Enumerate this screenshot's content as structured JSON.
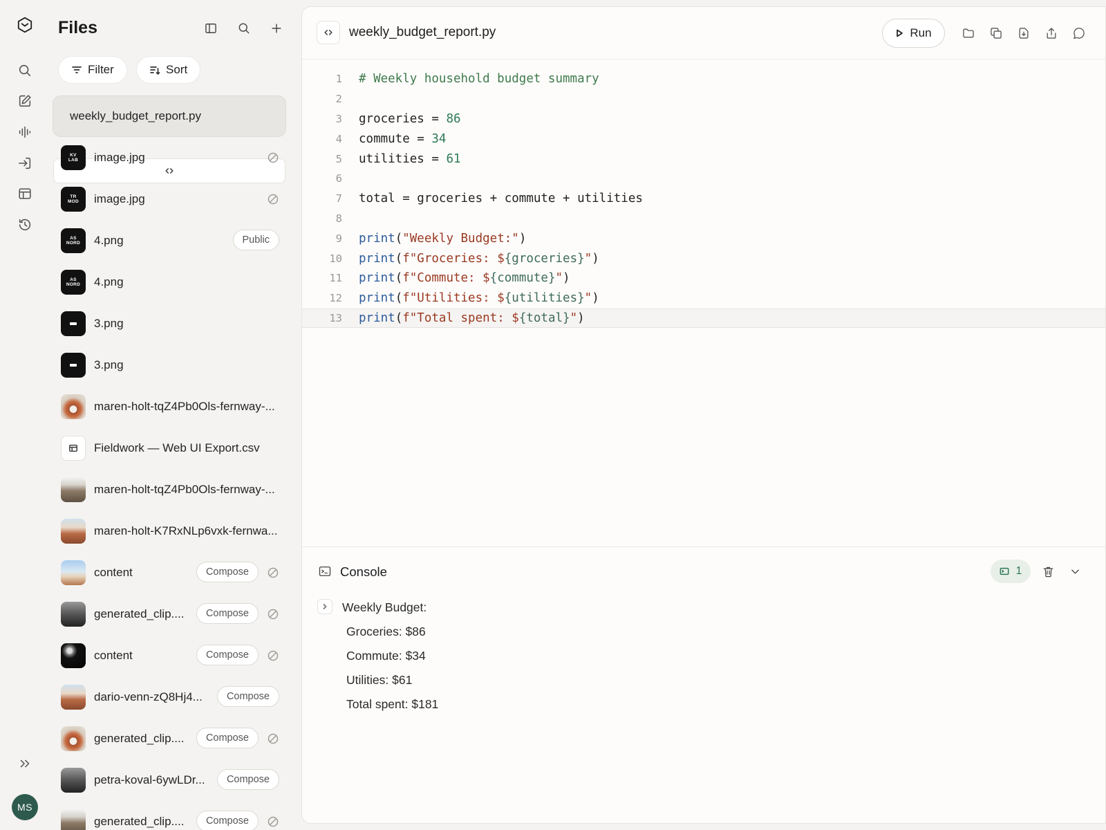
{
  "sidebar": {
    "title": "Files",
    "filter_label": "Filter",
    "sort_label": "Sort",
    "avatar_initials": "MS",
    "items": [
      {
        "name": "weekly_budget_report.py",
        "thumb": "code",
        "active": true
      },
      {
        "name": "image.jpg",
        "thumb": "logo",
        "logo_top": "KV",
        "logo_bottom": "LAB",
        "unshared": true
      },
      {
        "name": "image.jpg",
        "thumb": "logo",
        "logo_top": "TR",
        "logo_bottom": "MOD",
        "unshared": true
      },
      {
        "name": "4.png",
        "thumb": "logo",
        "logo_top": "AS",
        "logo_bottom": "NORD",
        "badge": "Public"
      },
      {
        "name": "4.png",
        "thumb": "logo",
        "logo_top": "AS",
        "logo_bottom": "NORD"
      },
      {
        "name": "3.png",
        "thumb": "dash"
      },
      {
        "name": "3.png",
        "thumb": "dash"
      },
      {
        "name": "maren-holt-tqZ4Pb0Ols-fernway-...",
        "thumb": "ring"
      },
      {
        "name": "Fieldwork — Web UI Export.csv",
        "thumb": "table"
      },
      {
        "name": "maren-holt-tqZ4Pb0Ols-fernway-...",
        "thumb": "rocks"
      },
      {
        "name": "maren-holt-K7RxNLp6vxk-fernwa...",
        "thumb": "canyon"
      },
      {
        "name": "content",
        "thumb": "desert",
        "badge": "Compose",
        "unshared": true
      },
      {
        "name": "generated_clip....",
        "thumb": "bw",
        "badge": "Compose",
        "unshared": true
      },
      {
        "name": "content",
        "thumb": "dark",
        "badge": "Compose",
        "unshared": true
      },
      {
        "name": "dario-venn-zQ8Hj4...",
        "thumb": "canyon",
        "badge": "Compose"
      },
      {
        "name": "generated_clip....",
        "thumb": "ring",
        "badge": "Compose",
        "unshared": true
      },
      {
        "name": "petra-koval-6ywLDr...",
        "thumb": "bw",
        "badge": "Compose"
      },
      {
        "name": "generated_clip....",
        "thumb": "rocks",
        "badge": "Compose",
        "unshared": true
      }
    ]
  },
  "editor": {
    "filename": "weekly_budget_report.py",
    "run_label": "Run",
    "current_line": 13,
    "lines": [
      [
        [
          "c-com",
          "# Weekly household budget summary"
        ]
      ],
      [],
      [
        [
          "",
          "groceries = "
        ],
        [
          "c-num",
          "86"
        ]
      ],
      [
        [
          "",
          "commute = "
        ],
        [
          "c-num",
          "34"
        ]
      ],
      [
        [
          "",
          "utilities = "
        ],
        [
          "c-num",
          "61"
        ]
      ],
      [],
      [
        [
          "",
          "total = groceries + commute + utilities"
        ]
      ],
      [],
      [
        [
          "c-fn",
          "print"
        ],
        [
          "",
          "("
        ],
        [
          "c-str",
          "\"Weekly Budget:\""
        ],
        [
          "",
          ")"
        ]
      ],
      [
        [
          "c-fn",
          "print"
        ],
        [
          "",
          "("
        ],
        [
          "c-str",
          "f\"Groceries: $"
        ],
        [
          "c-int",
          "{groceries}"
        ],
        [
          "c-str",
          "\""
        ],
        [
          "",
          ")"
        ]
      ],
      [
        [
          "c-fn",
          "print"
        ],
        [
          "",
          "("
        ],
        [
          "c-str",
          "f\"Commute: $"
        ],
        [
          "c-int",
          "{commute}"
        ],
        [
          "c-str",
          "\""
        ],
        [
          "",
          ")"
        ]
      ],
      [
        [
          "c-fn",
          "print"
        ],
        [
          "",
          "("
        ],
        [
          "c-str",
          "f\"Utilities: $"
        ],
        [
          "c-int",
          "{utilities}"
        ],
        [
          "c-str",
          "\""
        ],
        [
          "",
          ")"
        ]
      ],
      [
        [
          "c-fn",
          "print"
        ],
        [
          "",
          "("
        ],
        [
          "c-str",
          "f\"Total spent: $"
        ],
        [
          "c-int",
          "{total}"
        ],
        [
          "c-str",
          "\""
        ],
        [
          "",
          ")"
        ]
      ]
    ]
  },
  "console": {
    "title": "Console",
    "count": "1",
    "output": {
      "heading": "Weekly Budget:",
      "lines": [
        "Groceries: $86",
        "Commute: $34",
        "Utilities: $61",
        "Total spent: $181"
      ]
    }
  },
  "colors": {
    "accent": "#2e7a55",
    "avatar": "#2e5a4e",
    "background": "#f4f3f1"
  }
}
